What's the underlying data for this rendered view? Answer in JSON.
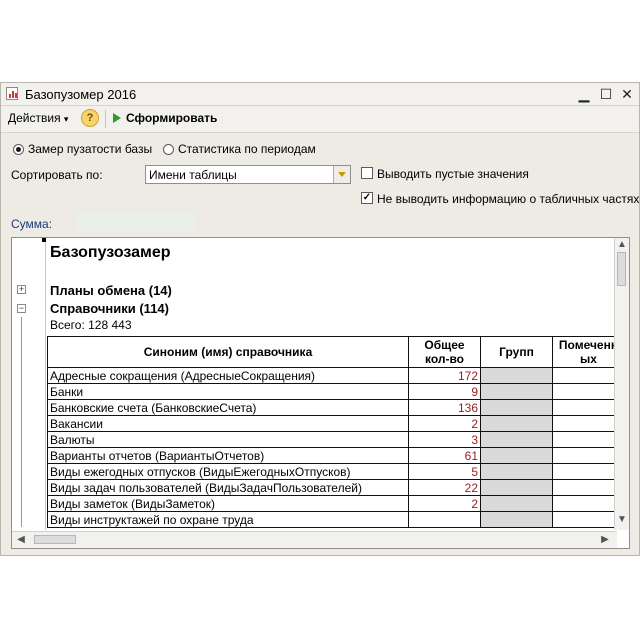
{
  "window": {
    "title": "Базопузомер 2016",
    "minimize": "▁",
    "maximize": "☐",
    "close": "✕"
  },
  "toolbar": {
    "actions_label": "Действия",
    "actions_arrow": "▾",
    "help": "?",
    "generate_label": "Сформировать"
  },
  "options": {
    "radio_measure": "Замер пузатости базы",
    "radio_stats": "Статистика по периодам",
    "sort_label": "Сортировать по:",
    "sort_value": "Имени таблицы",
    "check_empty": "Выводить пустые значения",
    "check_no_tables": "Не выводить информацию о табличных частях",
    "check_mark": "✓",
    "sum_label": "Сумма:"
  },
  "report": {
    "title": "Базопузозамер",
    "section_exchange": "Планы обмена (14)",
    "section_catalogs": "Справочники (114)",
    "total": "Всего: 128 443",
    "expand": "+",
    "collapse": "−",
    "columns": {
      "synonym": "Синоним (имя) справочника",
      "total": "Общее кол-во",
      "groups": "Групп",
      "marked": "Помеченных"
    },
    "rows": [
      {
        "name": "Адресные сокращения (АдресныеСокращения)",
        "count": "172"
      },
      {
        "name": "Банки",
        "count": "9"
      },
      {
        "name": "Банковские счета (БанковскиеСчета)",
        "count": "136"
      },
      {
        "name": "Вакансии",
        "count": "2"
      },
      {
        "name": "Валюты",
        "count": "3"
      },
      {
        "name": "Варианты отчетов (ВариантыОтчетов)",
        "count": "61"
      },
      {
        "name": "Виды ежегодных отпусков (ВидыЕжегодныхОтпусков)",
        "count": "5"
      },
      {
        "name": "Виды задач пользователей (ВидыЗадачПользователей)",
        "count": "22"
      },
      {
        "name": "Виды заметок (ВидыЗаметок)",
        "count": "2"
      },
      {
        "name": "Виды инструктажей по охране труда",
        "count": ""
      }
    ]
  },
  "scroll": {
    "up": "▲",
    "down": "▼",
    "left": "◀",
    "right": "▶"
  }
}
